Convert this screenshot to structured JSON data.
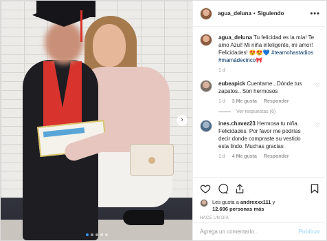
{
  "post": {
    "media_dots": 5,
    "active_dot": 1,
    "next_arrow": "›"
  },
  "header": {
    "username": "agua_deluna",
    "separator": "•",
    "follow_status": "Siguiendo",
    "more_icon": "more-dots-icon",
    "more_glyph": "•••"
  },
  "caption": {
    "username": "agua_deluna",
    "text": " Tu felicidad es la mía! Te amo Azul! Mi niña inteligente, mi amor! Felicidades! 😍😍💙",
    "hashtags": "#teamohastadios #mamádecinco🎀",
    "time": "1 d"
  },
  "comments": [
    {
      "username": "eubeapick",
      "text": " Cuentame.. Dónde tus zapatos.. Son hermosos",
      "time": "1 d",
      "likes": "3 Me gusta",
      "reply": "Responder",
      "view_replies": "Ver respuestas (6)"
    },
    {
      "username": "ines.chavez23",
      "text": " Hermosa tu niña. Felicidades. Por favor me podrías decir donde compraste su vestido esta lindo. Muchas gracias",
      "time": "1 d",
      "likes": "4 Me gusta",
      "reply": "Responder"
    }
  ],
  "likes": {
    "prefix": "Les gusta a ",
    "user": "andrexxx111",
    "middle": " y ",
    "count": "12.696 personas más"
  },
  "time_ago": "HACE UN DÍA",
  "add_comment": {
    "placeholder": "Agrega un comentario...",
    "publish": "Publicar"
  },
  "colors": {
    "link_blue": "#003569",
    "dot_active": "#3897f0",
    "publish_disabled": "#b2dffc"
  }
}
